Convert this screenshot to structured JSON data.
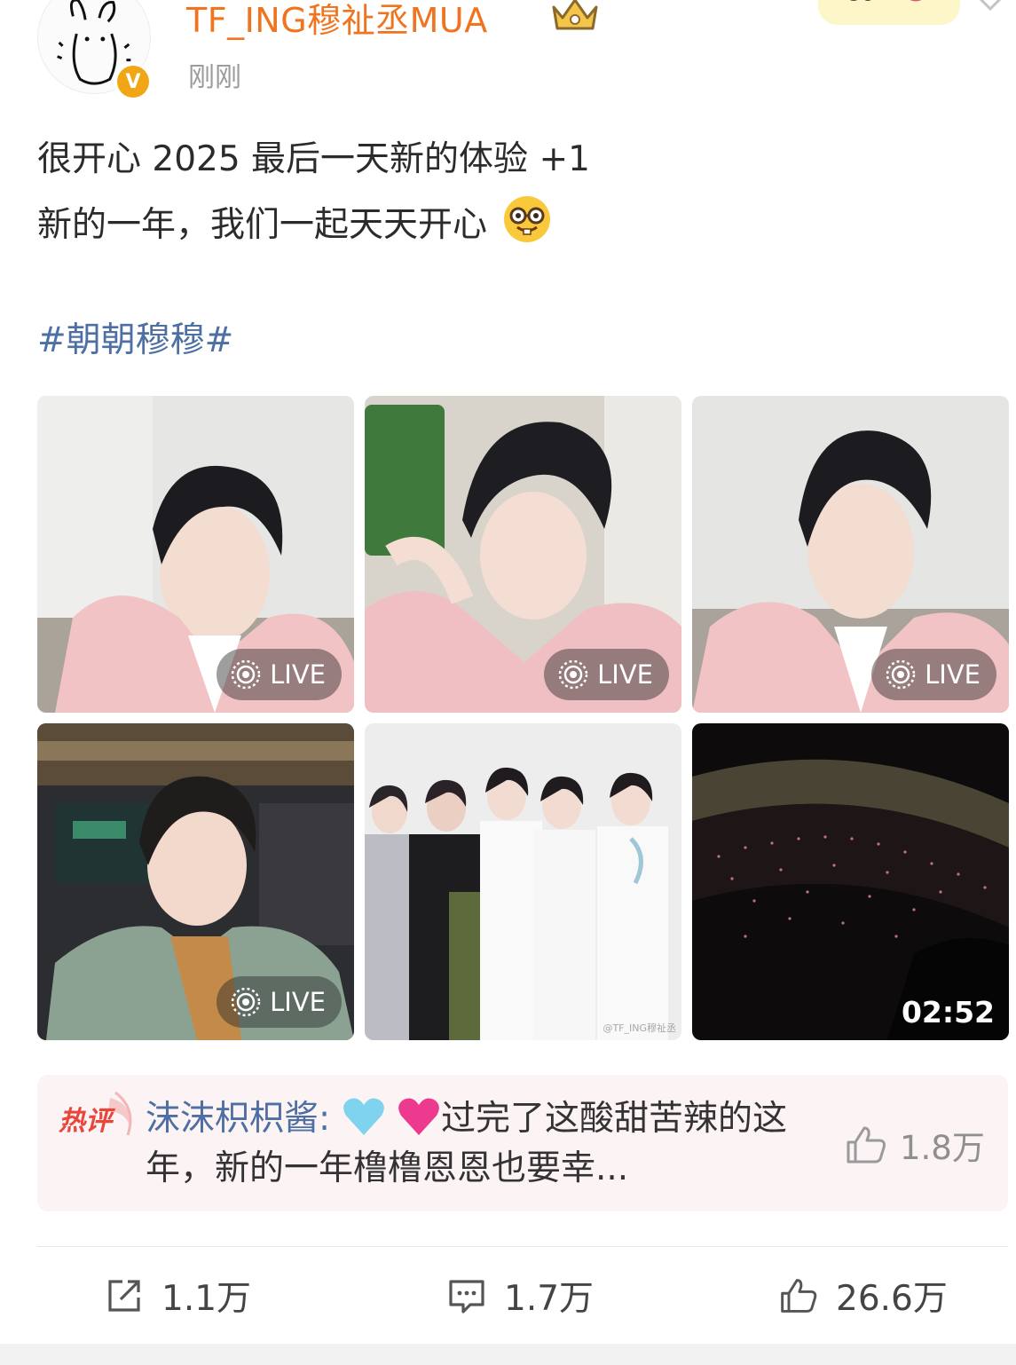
{
  "post": {
    "author": "TF_ING穆祉丞MUA",
    "timestamp": "刚刚",
    "lines": [
      "很开心 2025 最后一天新的体验 +1",
      "新的一年，我们一起天天开心"
    ],
    "hashtag": "#朝朝穆穆#",
    "icons": {
      "avatar": "avatar",
      "verified": "verified-badge-icon",
      "crown": "vip-crown-icon",
      "menu": "chevron-down-icon",
      "emoji": "nerd-face-emoji"
    },
    "verified_letter": "V"
  },
  "media": [
    {
      "type": "live-photo",
      "badge": "LIVE"
    },
    {
      "type": "live-photo",
      "badge": "LIVE"
    },
    {
      "type": "live-photo",
      "badge": "LIVE"
    },
    {
      "type": "live-photo",
      "badge": "LIVE"
    },
    {
      "type": "photo",
      "watermark": "@TF_ING穆祉丞"
    },
    {
      "type": "video",
      "duration": "02:52"
    }
  ],
  "hot_comment": {
    "label": "热评",
    "author": "沫沫枳枳酱:",
    "text": "过完了这酸甜苦辣的这年，新的一年橹橹恩恩也要幸...",
    "likes": "1.8万",
    "emojis": [
      "light-blue-heart",
      "pink-heart"
    ]
  },
  "actions": {
    "repost": {
      "count": "1.1万",
      "icon": "share-icon"
    },
    "comment": {
      "count": "1.7万",
      "icon": "comment-icon"
    },
    "like": {
      "count": "26.6万",
      "icon": "thumbs-up-icon"
    }
  },
  "colors": {
    "username": "#f0741f",
    "link": "#4d6fa3",
    "verified": "#f0a615",
    "hot_label": "#e8473a",
    "hot_background": "#fbf3f4"
  }
}
